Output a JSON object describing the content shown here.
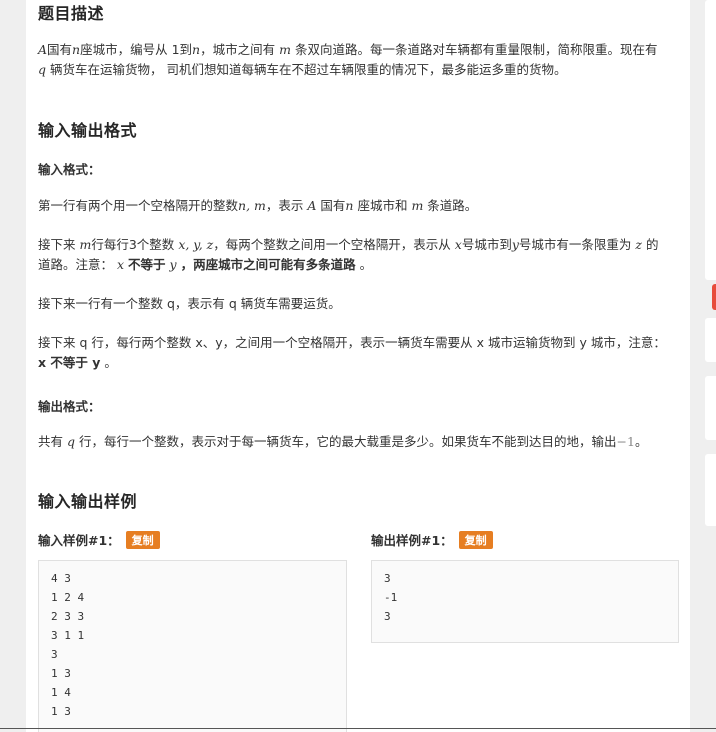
{
  "section_description": {
    "title": "题目描述",
    "p1_a": "A",
    "p1_b": "国有",
    "p1_c": "n",
    "p1_d": "座城市，编号从 1到",
    "p1_e": "n",
    "p1_f": "，城市之间有",
    "p1_g": "m",
    "p1_h": "条双向道路。每一条道路对车辆都有重量限制，简称限重。现在有",
    "p1_i": "q",
    "p1_j": "辆货车在运输货物， 司机们想知道每辆车在不超过车辆限重的情况下，最多能运多重的货物。"
  },
  "section_io": {
    "title": "输入输出格式",
    "input_label": "输入格式：",
    "l1_a": "第一行有两个用一个空格隔开的整数",
    "l1_b": "n, m",
    "l1_c": "，表示",
    "l1_d": "A",
    "l1_e": "国有",
    "l1_f": "n",
    "l1_g": "座城市和",
    "l1_h": "m",
    "l1_i": "条道路。",
    "l2_a": "接下来",
    "l2_b": "m",
    "l2_c": "行每行3个整数",
    "l2_d": "x, y, z",
    "l2_e": "，每两个整数之间用一个空格隔开，表示从",
    "l2_f": "x",
    "l2_g": "号城市到",
    "l2_h": "y",
    "l2_i": "号城市有一条限重为",
    "l2_j": "z",
    "l2_k": "的",
    "l2_l": "道路。注意：",
    "l2_m": "x",
    "l2_n": "不等于",
    "l2_o": "y",
    "l2_p": "，两座城市之间可能有多条道路",
    "l2_q": "。",
    "l3": "接下来一行有一个整数 q，表示有 q 辆货车需要运货。",
    "l4_a": "接下来 q 行，每行两个整数 x、y，之间用一个空格隔开，表示一辆货车需要从 x 城市运输货物到 y 城市，注意：",
    "l4_b": "x 不等于 y",
    "l4_c": "。",
    "output_label": "输出格式：",
    "o1_a": "共有",
    "o1_b": "q",
    "o1_c": "行，每行一个整数，表示对于每一辆货车，它的最大载重是多少。如果货车不能到达目的地，输出",
    "o1_d": "−1",
    "o1_e": "。"
  },
  "section_samples": {
    "title": "输入输出样例",
    "input_label": "输入样例#1：",
    "output_label": "输出样例#1：",
    "copy_label": "复制",
    "input_lines": [
      "4 3",
      "1 2 4",
      "2 3 3",
      "3 1 1",
      "3",
      "1 3",
      "1 4",
      "1 3"
    ],
    "output_lines": [
      "3",
      "-1",
      "3"
    ]
  },
  "colors": {
    "copy_button": "#e67e22",
    "accent_red": "#e74c3c"
  }
}
